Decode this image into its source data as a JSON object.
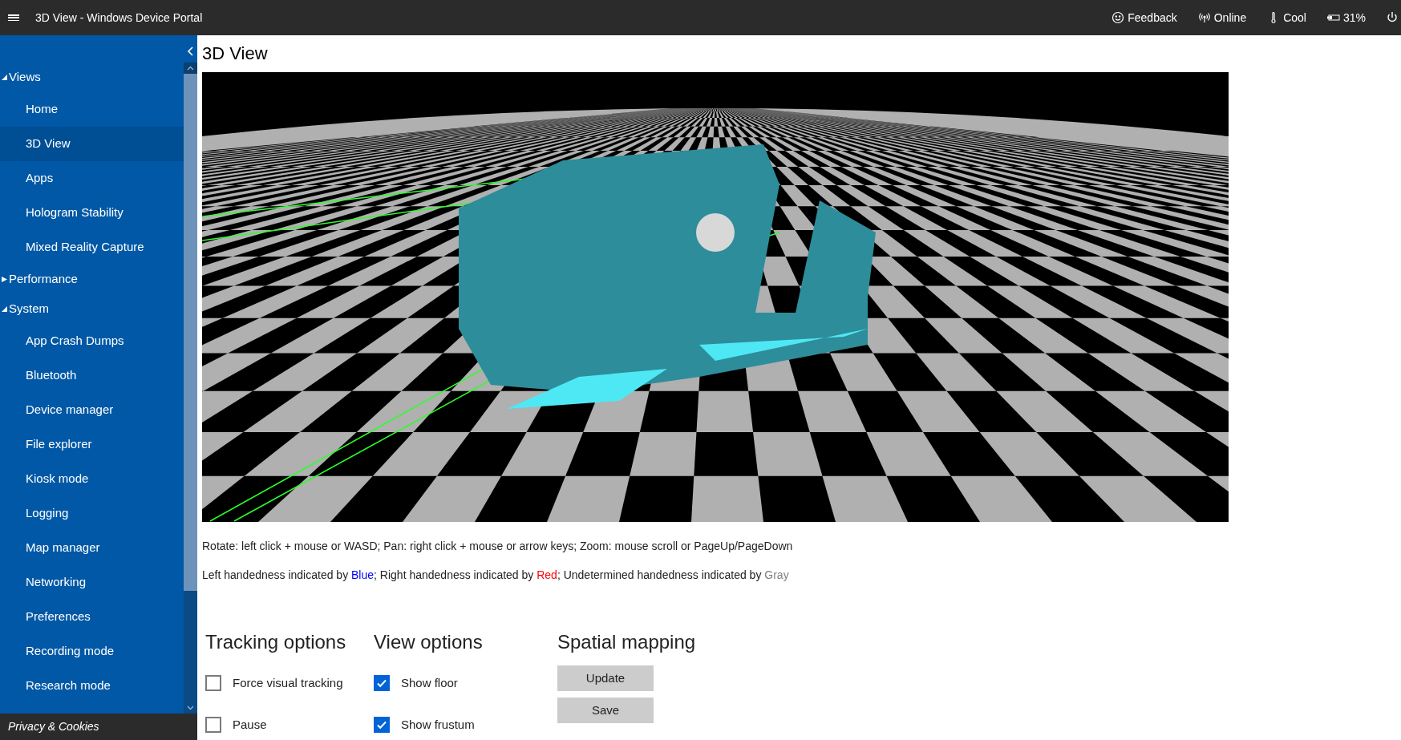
{
  "window": {
    "title": "3D View - Windows Device Portal"
  },
  "status": [
    {
      "kind": "feedback",
      "label": "Feedback"
    },
    {
      "kind": "online",
      "label": "Online"
    },
    {
      "kind": "thermal",
      "label": "Cool"
    },
    {
      "kind": "battery",
      "label": "31%"
    }
  ],
  "sidebar": {
    "groups": [
      {
        "label": "Views",
        "expanded": true,
        "children": [
          {
            "label": "Home",
            "selected": false
          },
          {
            "label": "3D View",
            "selected": true
          },
          {
            "label": "Apps",
            "selected": false
          },
          {
            "label": "Hologram Stability",
            "selected": false
          },
          {
            "label": "Mixed Reality Capture",
            "selected": false
          }
        ]
      },
      {
        "label": "Performance",
        "expanded": false
      },
      {
        "label": "System",
        "expanded": true,
        "children": [
          {
            "label": "App Crash Dumps",
            "selected": false
          },
          {
            "label": "Bluetooth",
            "selected": false
          },
          {
            "label": "Device manager",
            "selected": false
          },
          {
            "label": "File explorer",
            "selected": false
          },
          {
            "label": "Kiosk mode",
            "selected": false
          },
          {
            "label": "Logging",
            "selected": false
          },
          {
            "label": "Map manager",
            "selected": false
          },
          {
            "label": "Networking",
            "selected": false
          },
          {
            "label": "Preferences",
            "selected": false
          },
          {
            "label": "Recording mode",
            "selected": false
          },
          {
            "label": "Research mode",
            "selected": false
          }
        ]
      }
    ],
    "footer": "Privacy & Cookies"
  },
  "page": {
    "title": "3D View",
    "controls_help": "Rotate: left click + mouse or WASD; Pan: right click + mouse or arrow keys; Zoom: mouse scroll or PageUp/PageDown",
    "legend": [
      {
        "text": "Left handedness indicated by "
      },
      {
        "text": "Blue",
        "color": "#0000ff"
      },
      {
        "text": "; Right handedness indicated by "
      },
      {
        "text": "Red",
        "color": "#ff0000"
      },
      {
        "text": "; Undetermined handedness indicated by "
      },
      {
        "text": "Gray",
        "color": "#808080"
      }
    ],
    "tracking_options": {
      "title": "Tracking options",
      "items": [
        {
          "label": "Force visual tracking",
          "checked": false
        },
        {
          "label": "Pause",
          "checked": false
        }
      ]
    },
    "view_options": {
      "title": "View options",
      "items": [
        {
          "label": "Show floor",
          "checked": true
        },
        {
          "label": "Show frustum",
          "checked": true
        }
      ]
    },
    "spatial_mapping": {
      "title": "Spatial mapping",
      "buttons": [
        "Update",
        "Save"
      ]
    }
  }
}
